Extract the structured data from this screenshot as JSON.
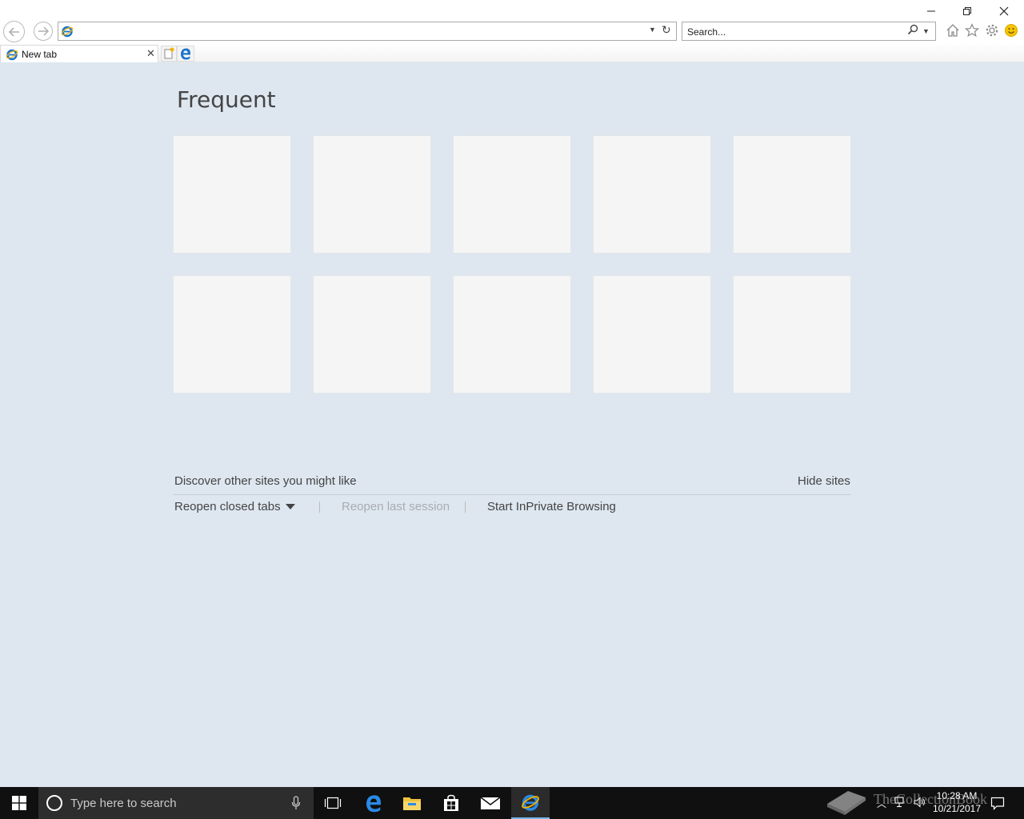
{
  "window": {
    "minimize": "🗕",
    "restore": "🗗",
    "close": "✕"
  },
  "toolbar": {
    "address_value": "",
    "search_placeholder": "Search..."
  },
  "tabs": [
    {
      "label": "New tab",
      "active": true
    }
  ],
  "content": {
    "title": "Frequent",
    "tile_count": 10,
    "discover_label": "Discover other sites you might like",
    "hide_sites_label": "Hide sites",
    "reopen_closed_label": "Reopen closed tabs",
    "reopen_last_label": "Reopen last session",
    "inprivate_label": "Start InPrivate Browsing"
  },
  "taskbar": {
    "search_placeholder": "Type here to search",
    "apps": [
      "task-view-icon",
      "edge-icon",
      "file-explorer-icon",
      "store-icon",
      "mail-icon",
      "internet-explorer-icon"
    ]
  },
  "tray": {
    "time": "10:28 AM",
    "date": "10/21/2017"
  },
  "watermark": {
    "text": "TheCollectionBook"
  },
  "colors": {
    "content_bg": "#dee7f0",
    "tile_bg": "#f5f5f5",
    "taskbar_bg": "#101010",
    "accent": "#1a73c8"
  }
}
